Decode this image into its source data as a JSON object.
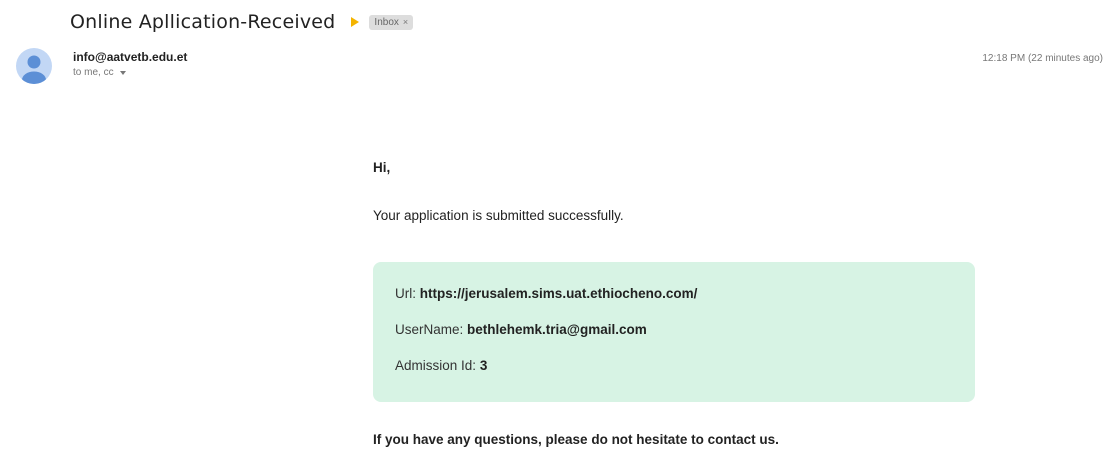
{
  "email": {
    "subject": "Online Apllication-Received",
    "label_chip": "Inbox",
    "label_chip_close": "×",
    "sender": "info@aatvetb.edu.et",
    "recipients": "to me, cc",
    "timestamp": "12:18 PM (22 minutes ago)"
  },
  "body": {
    "greeting": "Hi,",
    "message": "Your application is submitted successfully.",
    "details": {
      "url_label": "Url:",
      "url_value": "https://jerusalem.sims.uat.ethiocheno.com/",
      "username_label": "UserName:",
      "username_value": "bethlehemk.tria@gmail.com",
      "admission_label": "Admission Id:",
      "admission_value": "3"
    },
    "closing": "If you have any questions, please do not hesitate to contact us."
  },
  "colors": {
    "importance_marker": "#f4b400",
    "details_background": "#d7f3e4",
    "avatar_background": "#c2d7f5"
  },
  "icons": {
    "importance": "importance-marker-icon",
    "avatar": "person-avatar-icon",
    "recipients_dropdown": "chevron-down-icon"
  }
}
